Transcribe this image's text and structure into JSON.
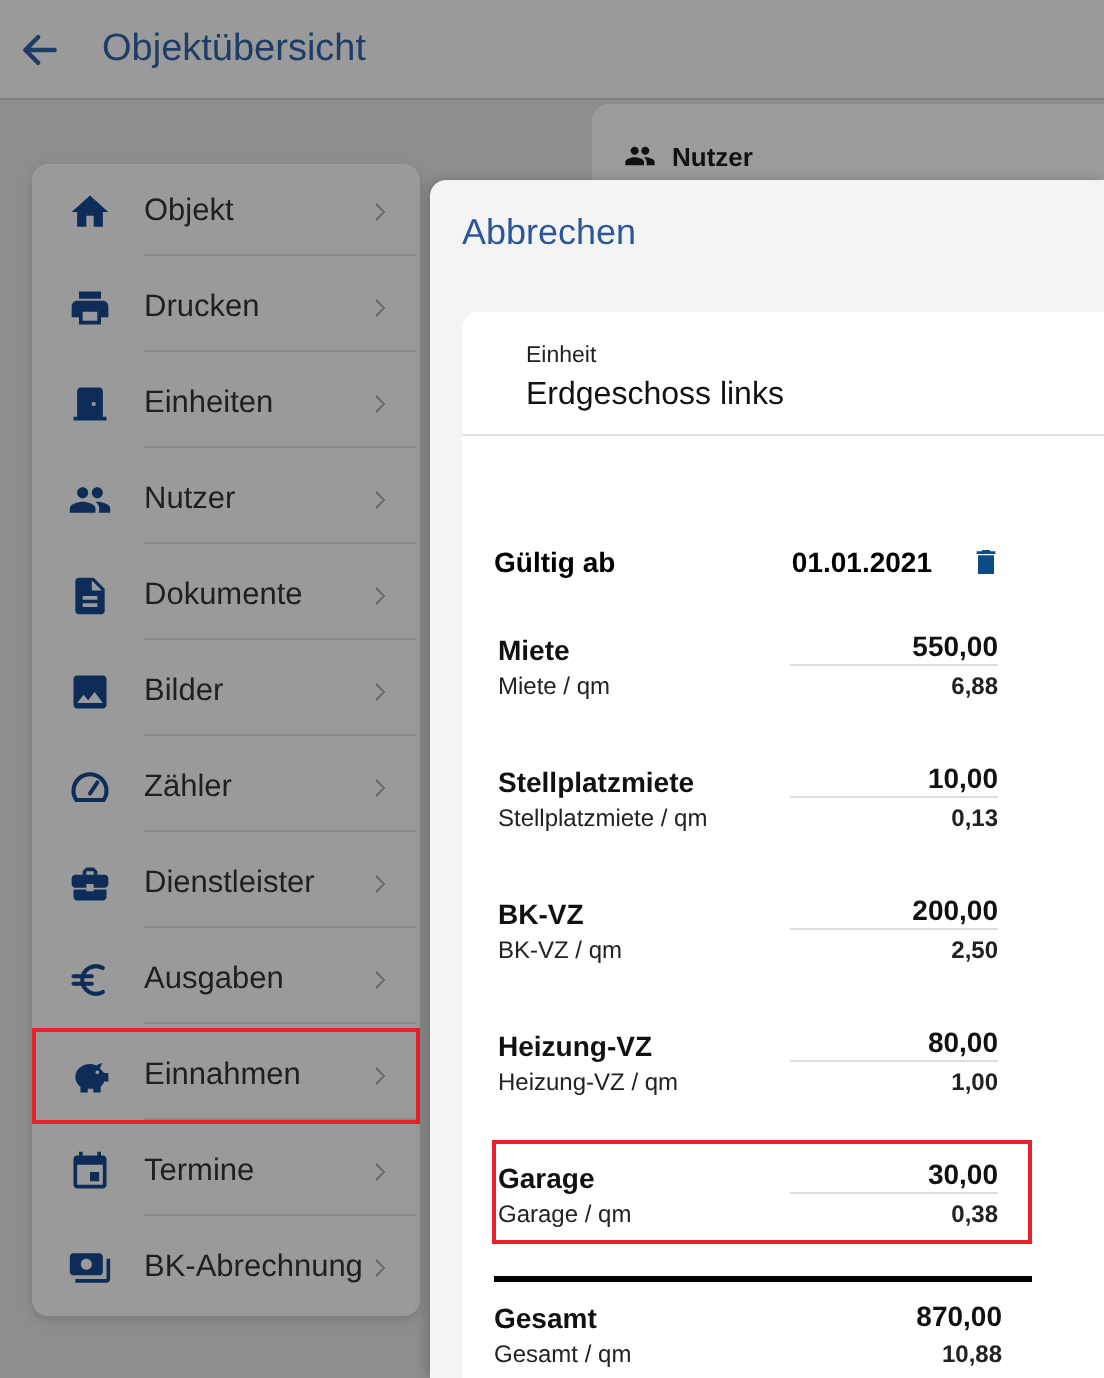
{
  "header": {
    "title": "Objektübersicht"
  },
  "menu": [
    {
      "label": "Objekt",
      "highlighted": false
    },
    {
      "label": "Drucken",
      "highlighted": false
    },
    {
      "label": "Einheiten",
      "highlighted": false
    },
    {
      "label": "Nutzer",
      "highlighted": false
    },
    {
      "label": "Dokumente",
      "highlighted": false
    },
    {
      "label": "Bilder",
      "highlighted": false
    },
    {
      "label": "Zähler",
      "highlighted": false
    },
    {
      "label": "Dienstleister",
      "highlighted": false
    },
    {
      "label": "Ausgaben",
      "highlighted": false
    },
    {
      "label": "Einnahmen",
      "highlighted": true
    },
    {
      "label": "Termine",
      "highlighted": false
    },
    {
      "label": "BK-Abrechnung",
      "highlighted": false
    }
  ],
  "background_card": {
    "title": "Nutzer"
  },
  "dialog": {
    "cancel": "Abbrechen",
    "unit_label": "Einheit",
    "unit_value": "Erdgeschoss links",
    "valid_from": {
      "label": "Gültig ab",
      "value": "01.01.2021"
    },
    "items": [
      {
        "label": "Miete",
        "value": "550,00",
        "per_sqm_label": "Miete / qm",
        "per_sqm_value": "6,88",
        "highlighted": false
      },
      {
        "label": "Stellplatzmiete",
        "value": "10,00",
        "per_sqm_label": "Stellplatzmiete / qm",
        "per_sqm_value": "0,13",
        "highlighted": false
      },
      {
        "label": "BK-VZ",
        "value": "200,00",
        "per_sqm_label": "BK-VZ / qm",
        "per_sqm_value": "2,50",
        "highlighted": false
      },
      {
        "label": "Heizung-VZ",
        "value": "80,00",
        "per_sqm_label": "Heizung-VZ / qm",
        "per_sqm_value": "1,00",
        "highlighted": false
      },
      {
        "label": "Garage",
        "value": "30,00",
        "per_sqm_label": "Garage / qm",
        "per_sqm_value": "0,38",
        "highlighted": true
      }
    ],
    "total": {
      "label": "Gesamt",
      "value": "870,00",
      "per_sqm_label": "Gesamt / qm",
      "per_sqm_value": "10,88"
    }
  }
}
